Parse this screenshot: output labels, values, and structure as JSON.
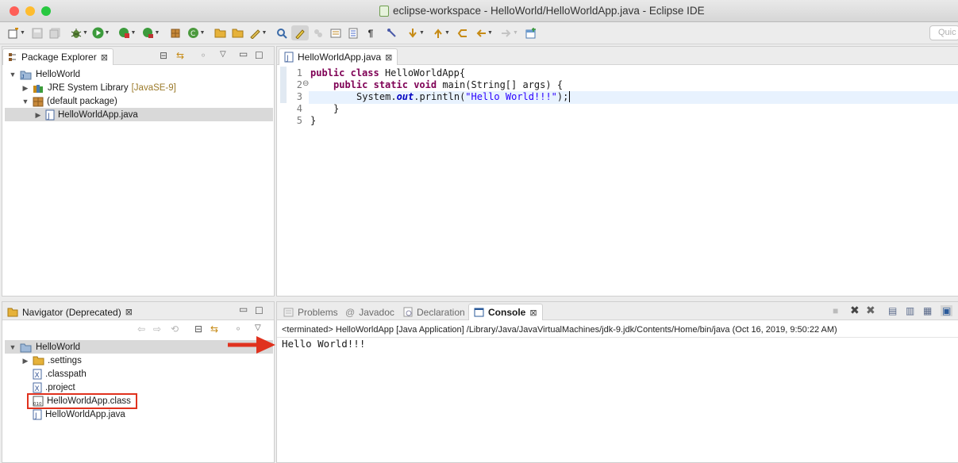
{
  "window": {
    "title": "eclipse-workspace - HelloWorld/HelloWorldApp.java - Eclipse IDE",
    "traffic_lights": [
      "#ff5f57",
      "#febc2e",
      "#28c840"
    ]
  },
  "toolbar": {
    "icons": [
      "new-wizard-icon",
      "save-icon",
      "save-all-icon",
      "debug-icon",
      "run-icon",
      "coverage-icon",
      "run-last-icon",
      "open-type-icon",
      "new-java-class-icon",
      "open-folder-icon",
      "pen-icon",
      "search-icon",
      "highlight-icon",
      "pin-icon",
      "next-annotation-icon",
      "prev-annotation-icon",
      "back-icon",
      "forward-icon",
      "perspective-icon"
    ],
    "quick_access_placeholder": "Quic"
  },
  "package_explorer": {
    "title": "Package Explorer",
    "items": [
      {
        "label": "HelloWorld"
      },
      {
        "label": "JRE System Library",
        "suffix": "[JavaSE-9]"
      },
      {
        "label": "(default package)"
      },
      {
        "label": "HelloWorldApp.java"
      }
    ]
  },
  "editor": {
    "tab_label": "HelloWorldApp.java",
    "lines": [
      {
        "num": "1"
      },
      {
        "num": "2"
      },
      {
        "num": "3"
      },
      {
        "num": "4"
      },
      {
        "num": "5"
      }
    ],
    "code": {
      "l1_kw1": "public",
      "l1_kw2": "class",
      "l1_rest": "HelloWorldApp{",
      "l2_kw1": "public",
      "l2_kw2": "static",
      "l2_kw3": "void",
      "l2_rest": "main(String[] args) {",
      "l3_pre": "System.",
      "l3_field": "out",
      "l3_mid": ".println(",
      "l3_str": "\"Hello World!!!\"",
      "l3_end": ");",
      "l4": "}",
      "l5": "}"
    }
  },
  "navigator": {
    "title": "Navigator (Deprecated)",
    "items": [
      {
        "label": "HelloWorld"
      },
      {
        "label": ".settings"
      },
      {
        "label": ".classpath"
      },
      {
        "label": ".project"
      },
      {
        "label": "HelloWorldApp.class"
      },
      {
        "label": "HelloWorldApp.java"
      }
    ]
  },
  "bottom_tabs": [
    {
      "label": "Problems"
    },
    {
      "label": "Javadoc"
    },
    {
      "label": "Declaration"
    },
    {
      "label": "Console"
    }
  ],
  "console": {
    "status": "<terminated> HelloWorldApp [Java Application] /Library/Java/JavaVirtualMachines/jdk-9.jdk/Contents/Home/bin/java (Oct 16, 2019, 9:50:22 AM)",
    "output": "Hello World!!!"
  },
  "colors": {
    "highlight_red": "#e0321e",
    "selection": "#d9d9d9",
    "keyword": "#7f0055",
    "string": "#2a00ff"
  }
}
